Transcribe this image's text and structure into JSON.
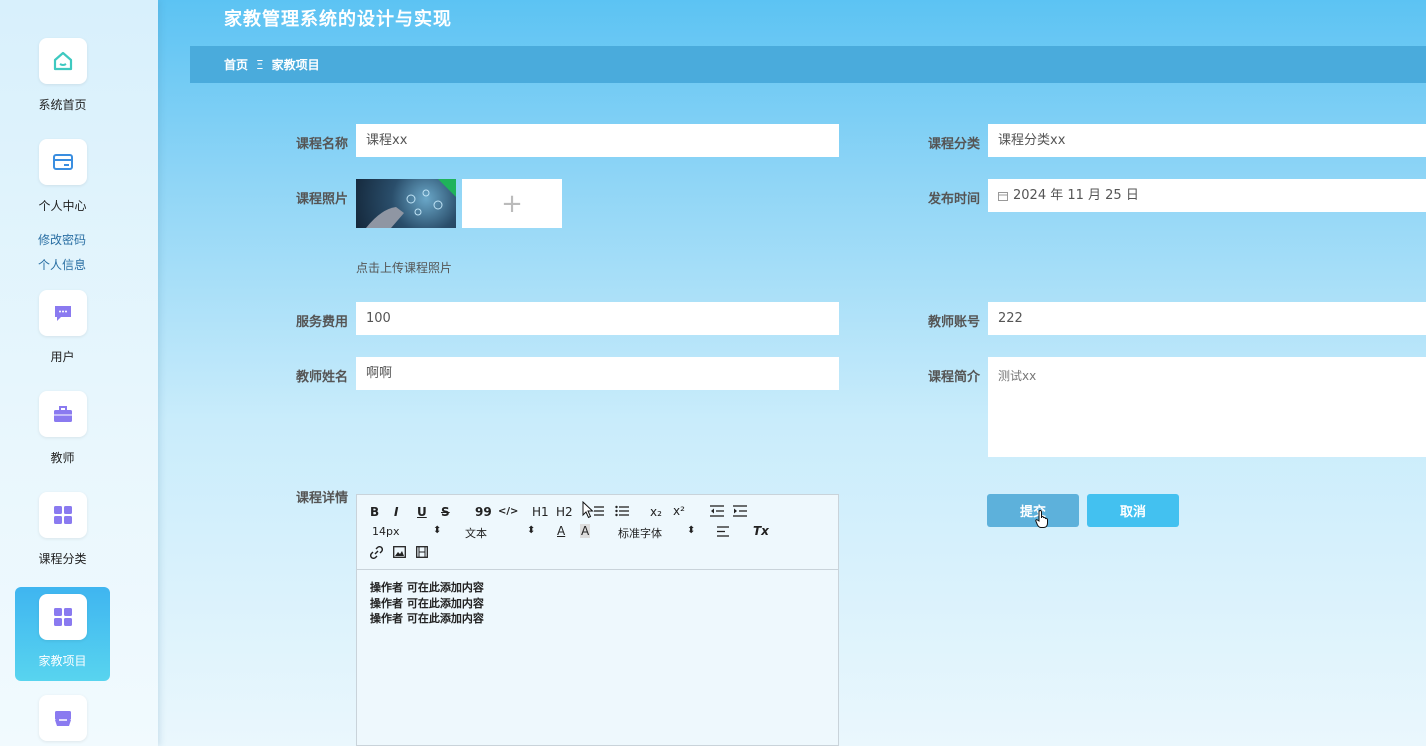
{
  "app_title": "家教管理系统的设计与实现",
  "breadcrumb": {
    "home": "首页",
    "separator": "Ξ",
    "current": "家教项目"
  },
  "sidebar": {
    "items": [
      {
        "label": "系统首页",
        "icon": "home-icon"
      },
      {
        "label": "个人中心",
        "icon": "card-icon"
      },
      {
        "label": "用户",
        "icon": "chat-icon"
      },
      {
        "label": "教师",
        "icon": "briefcase-icon"
      },
      {
        "label": "课程分类",
        "icon": "grid-icon"
      },
      {
        "label": "家教项目",
        "icon": "grid-icon"
      },
      {
        "label": "",
        "icon": "inbox-icon"
      }
    ],
    "sub_items": [
      "修改密码",
      "个人信息"
    ]
  },
  "form": {
    "course_name": {
      "label": "课程名称",
      "value": "课程xx"
    },
    "course_category": {
      "label": "课程分类",
      "value": "课程分类xx"
    },
    "course_photo": {
      "label": "课程照片",
      "upload_hint": "点击上传课程照片",
      "add_symbol": "+"
    },
    "publish_time": {
      "label": "发布时间",
      "value": "2024 年 11 月 25 日"
    },
    "service_fee": {
      "label": "服务费用",
      "value": "100"
    },
    "teacher_account": {
      "label": "教师账号",
      "value": "222"
    },
    "teacher_name": {
      "label": "教师姓名",
      "value": "啊啊"
    },
    "course_intro": {
      "label": "课程简介",
      "value": "测试xx"
    },
    "course_detail": {
      "label": "课程详情",
      "toolbar": {
        "bold": "B",
        "italic": "I",
        "underline": "U",
        "strike": "S",
        "quote": "99",
        "code": "</>",
        "h1": "H1",
        "h2": "H2",
        "sub": "x₂",
        "sup": "x²",
        "font_size": "14px",
        "text_type": "文本",
        "font_family": "标准字体",
        "font_color": "A",
        "bg_color": "A",
        "clear": "Tx"
      },
      "content_lines": [
        "操作者  可在此添加内容",
        "操作者  可在此添加内容",
        "操作者  可在此添加内容"
      ]
    }
  },
  "buttons": {
    "submit": "提交",
    "cancel": "取消"
  },
  "colors": {
    "accent": "#4aabdc",
    "active_menu": "#3fb5f0",
    "submit": "#5db1db",
    "cancel": "#43c1f0"
  }
}
